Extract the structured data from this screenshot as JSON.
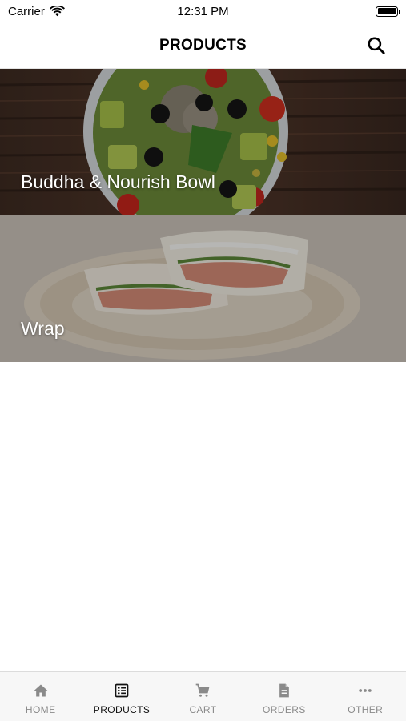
{
  "status_bar": {
    "carrier": "Carrier",
    "time": "12:31 PM"
  },
  "header": {
    "title": "PRODUCTS",
    "search_icon": "search-icon"
  },
  "products": [
    {
      "name": "Buddha & Nourish Bowl",
      "image": "salad-bowl-photo"
    },
    {
      "name": "Wrap",
      "image": "wrap-on-plate-photo"
    }
  ],
  "tabs": [
    {
      "label": "HOME",
      "icon": "home-icon",
      "active": false
    },
    {
      "label": "PRODUCTS",
      "icon": "list-icon",
      "active": true
    },
    {
      "label": "CART",
      "icon": "cart-icon",
      "active": false
    },
    {
      "label": "ORDERS",
      "icon": "document-icon",
      "active": false
    },
    {
      "label": "OTHER",
      "icon": "more-icon",
      "active": false
    }
  ],
  "colors": {
    "active_tab": "#111111",
    "inactive_tab": "#8a8a8a",
    "tab_bar_bg": "#f7f7f7"
  }
}
